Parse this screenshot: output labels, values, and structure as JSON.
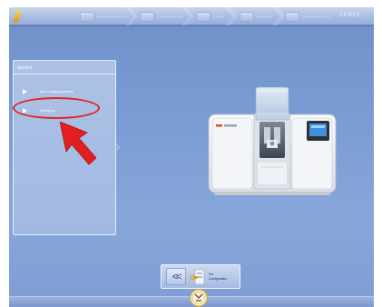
{
  "topbar": {
    "steps": [
      {
        "label": "ADMINISTRATION",
        "icon": "admin-step-icon"
      },
      {
        "label": "PREPARATION",
        "icon": "preparation-step-icon"
      },
      {
        "label": "SCAN",
        "icon": "scan-step-icon"
      },
      {
        "label": "DESIGN",
        "icon": "design-step-icon"
      },
      {
        "label": "MANUFACTURE",
        "icon": "manufacture-step-icon"
      }
    ],
    "brand": "CEREC"
  },
  "service_panel": {
    "title": "Service",
    "items": [
      {
        "label": "Start a cleaning process",
        "icon": "play-icon"
      },
      {
        "label": "Emergency",
        "icon": "play-icon"
      }
    ]
  },
  "bottom_nav": {
    "back_label": "<<",
    "config_label_line1": "Set",
    "config_label_line2": "Configuration"
  },
  "colors": {
    "background": "#7f9dd3",
    "highlight": "#e22222",
    "panel_border": "#f0f5ff"
  }
}
